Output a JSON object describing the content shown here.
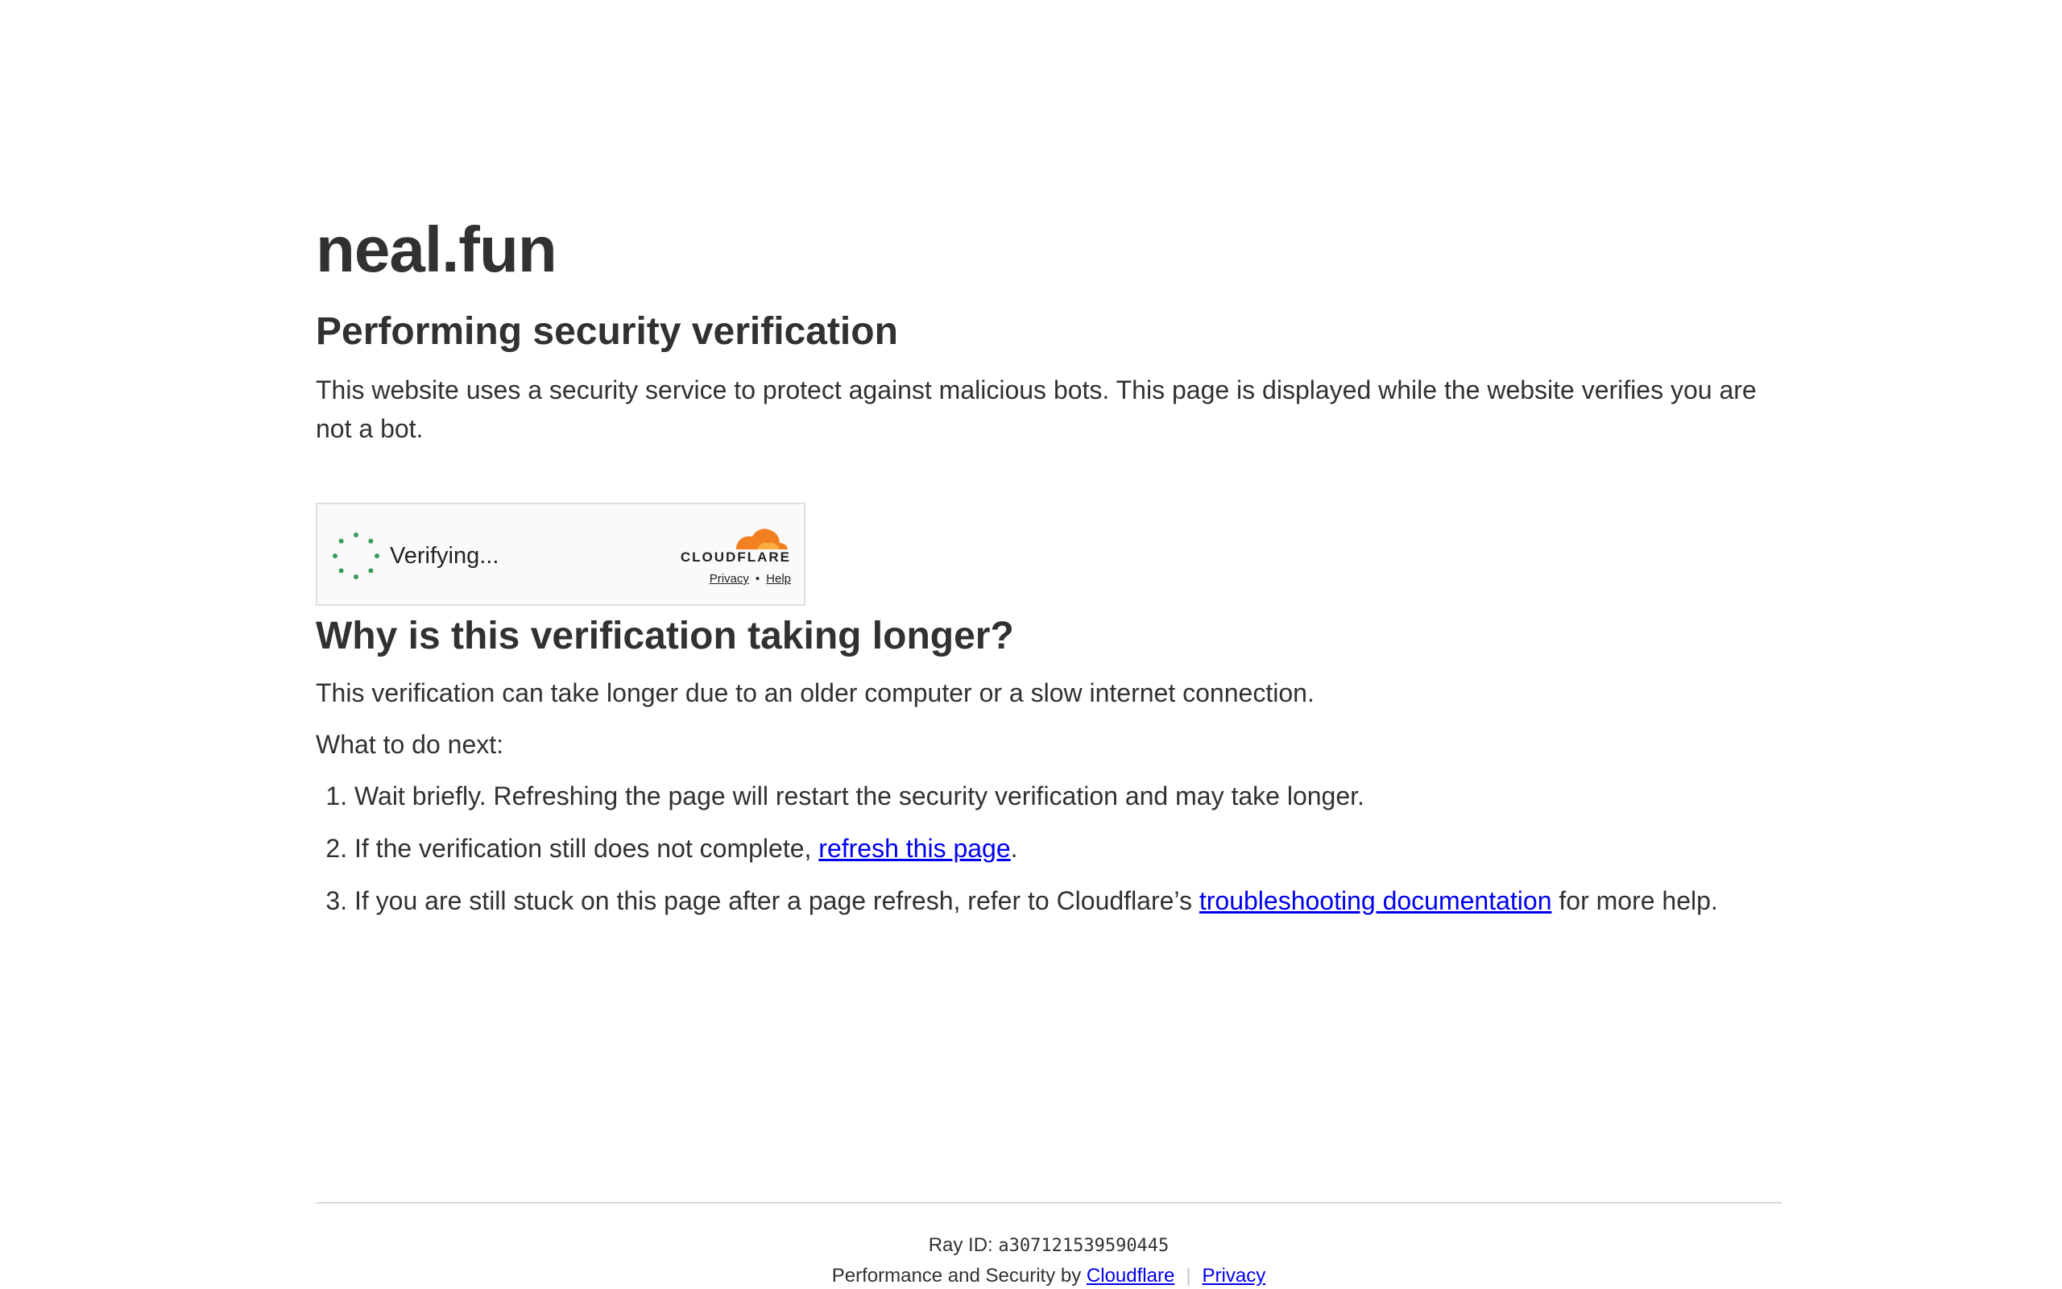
{
  "site": {
    "title": "neal.fun"
  },
  "verification": {
    "heading": "Performing security verification",
    "description": "This website uses a security service to protect against malicious bots. This page is displayed while the website verifies you are not a bot."
  },
  "widget": {
    "status": "Verifying...",
    "brand": "CLOUDFLARE",
    "privacy_label": "Privacy",
    "separator": "•",
    "help_label": "Help",
    "spinner_color": "#3a9a5b",
    "logo_color": "#f38020"
  },
  "why": {
    "heading": "Why is this verification taking longer?",
    "explanation": "This verification can take longer due to an older computer or a slow internet connection.",
    "next_label": "What to do next:",
    "steps": [
      {
        "text": "Wait briefly. Refreshing the page will restart the security verification and may take longer."
      },
      {
        "prefix": "If the verification still does not complete, ",
        "link": "refresh this page",
        "suffix": "."
      },
      {
        "prefix": "If you are still stuck on this page after a page refresh, refer to Cloudflare’s ",
        "link": "troubleshooting documentation",
        "suffix": " for more help."
      }
    ]
  },
  "footer": {
    "ray_label": "Ray ID: ",
    "ray_id": "a307121539590445",
    "perf_prefix": "Performance and Security by ",
    "cloudflare_link": "Cloudflare",
    "separator": "|",
    "privacy_link": "Privacy"
  },
  "colors": {
    "text": "#313131",
    "link": "#0000ee",
    "divider": "#d9d9d9"
  }
}
